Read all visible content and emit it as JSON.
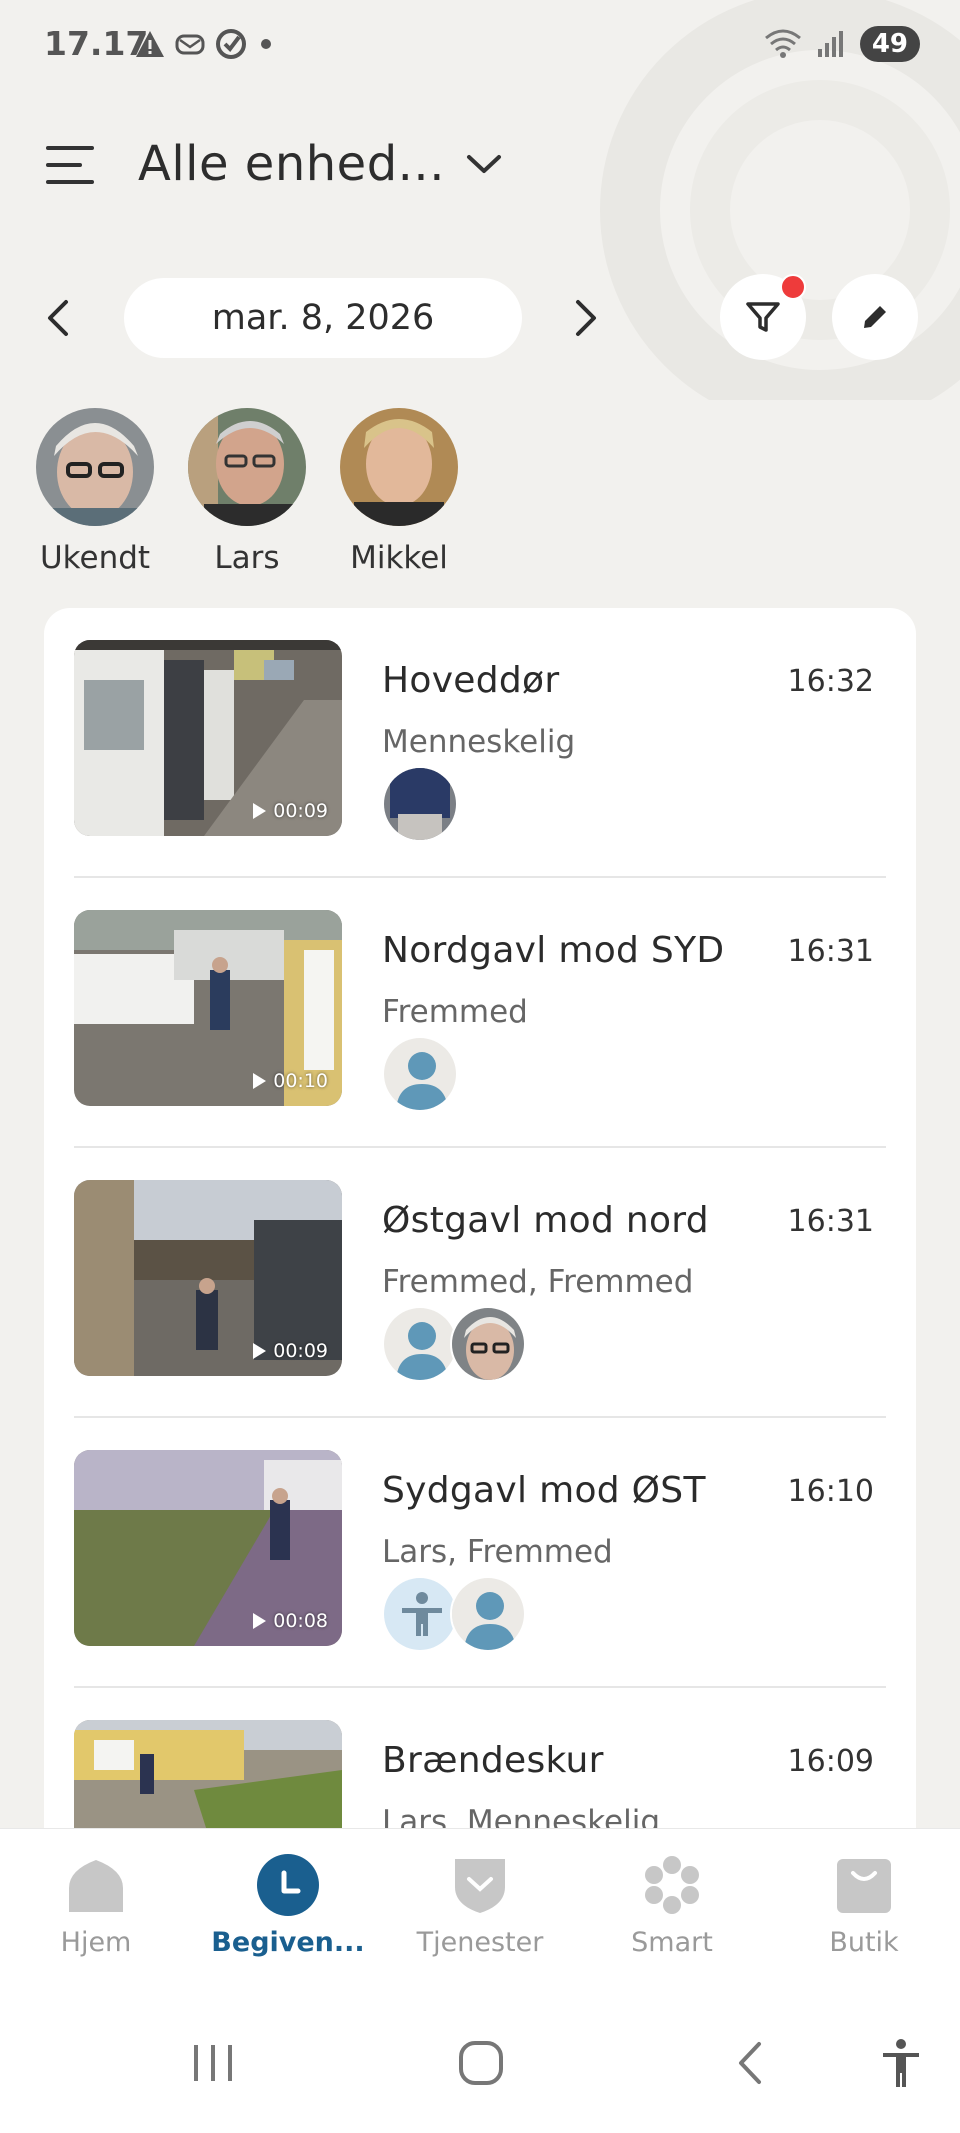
{
  "status_bar": {
    "time": "17.17",
    "battery": "49"
  },
  "header": {
    "device_selector": "Alle enhed..."
  },
  "date_nav": {
    "date": "mar. 8, 2026"
  },
  "faces": [
    {
      "label": "Ukendt"
    },
    {
      "label": "Lars"
    },
    {
      "label": "Mikkel"
    }
  ],
  "events": [
    {
      "title": "Hoveddør",
      "time": "16:32",
      "subtitle": "Menneskelig",
      "duration": "00:09"
    },
    {
      "title": "Nordgavl mod SYD",
      "time": "16:31",
      "subtitle": "Fremmed",
      "duration": "00:10"
    },
    {
      "title": "Østgavl mod nord",
      "time": "16:31",
      "subtitle": "Fremmed, Fremmed",
      "duration": "00:09"
    },
    {
      "title": "Sydgavl mod ØST",
      "time": "16:10",
      "subtitle": "Lars, Fremmed",
      "duration": "00:08"
    },
    {
      "title": "Brændeskur",
      "time": "16:09",
      "subtitle": "Lars, Menneskelig",
      "duration": ""
    }
  ],
  "bottom_nav": [
    {
      "label": "Hjem",
      "icon": "home-icon",
      "active": false
    },
    {
      "label": "Begiven...",
      "icon": "clock-icon",
      "active": true
    },
    {
      "label": "Tjenester",
      "icon": "shield-icon",
      "active": false
    },
    {
      "label": "Smart",
      "icon": "smart-icon",
      "active": false
    },
    {
      "label": "Butik",
      "icon": "bag-icon",
      "active": false
    }
  ],
  "colors": {
    "accent": "#1a5f8f",
    "notification_dot": "#ee3b3b",
    "background": "#f2f1ee"
  }
}
